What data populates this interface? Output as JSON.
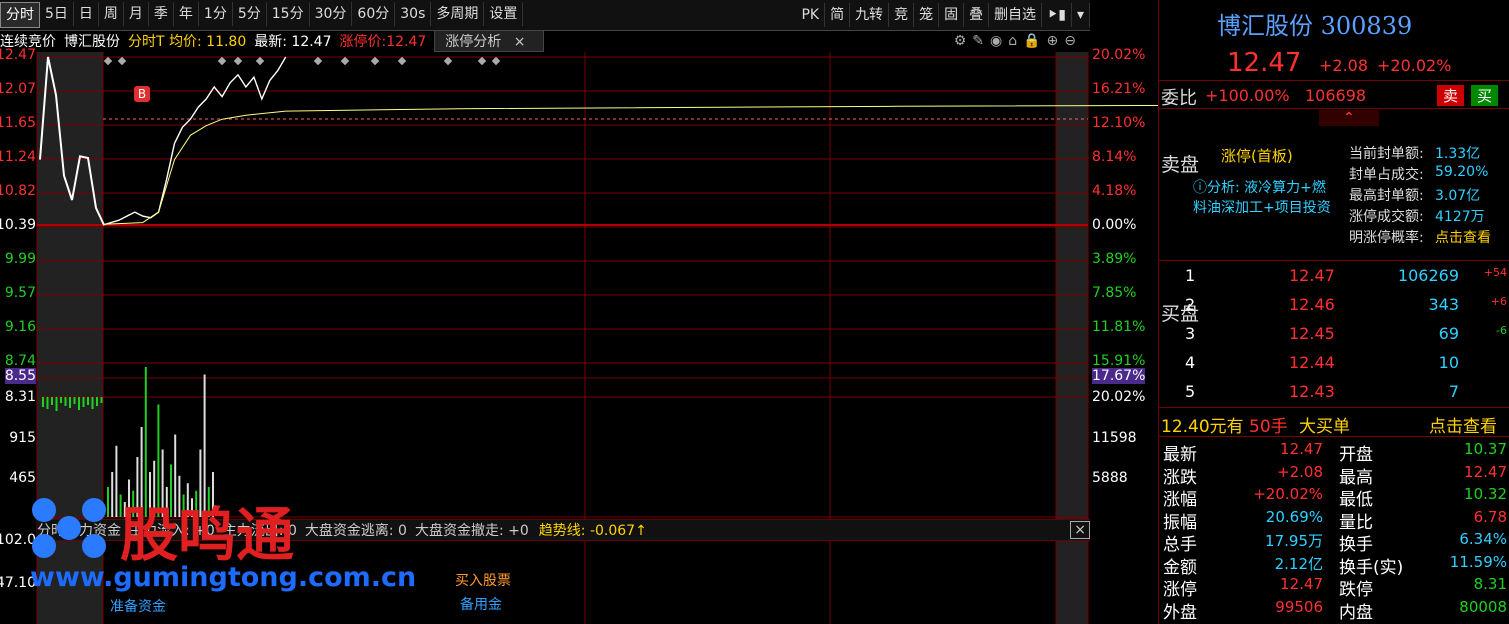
{
  "toolbar": {
    "left": [
      "分时",
      "5日",
      "日",
      "周",
      "月",
      "季",
      "年",
      "1分",
      "5分",
      "15分",
      "30分",
      "60分",
      "30s",
      "多周期",
      "设置"
    ],
    "right": [
      "PK",
      "简",
      "九转",
      "竞",
      "笼",
      "固",
      "叠",
      "删自选"
    ]
  },
  "info": {
    "auction": "连续竞价",
    "stock_name": "博汇股份",
    "avg": "分时T 均价: 11.80",
    "latest": "最新: 12.47",
    "limit": "涨停价:12.47",
    "analysis_btn": "涨停分析"
  },
  "price_axis_left": [
    "12.47",
    "12.07",
    "11.65",
    "11.24",
    "10.82",
    "10.39",
    "9.99",
    "9.57",
    "9.16",
    "8.74",
    "8.55"
  ],
  "pct_axis_right": [
    "20.02%",
    "16.21%",
    "12.10%",
    "8.14%",
    "4.18%",
    "0.00%",
    "3.89%",
    "7.85%",
    "11.81%",
    "15.91%",
    "17.67%"
  ],
  "vol_axis_left": [
    "8.31",
    "915",
    "465",
    "102.0",
    "47.10"
  ],
  "vol_axis_right": [
    "20.02%",
    "11598",
    "5888"
  ],
  "buy_marker": "B",
  "flow_bar": {
    "items": [
      "分时主力资金",
      "主力流入: +0",
      "主力流出: 0",
      "大盘资金逃离: 0",
      "大盘资金撤走: +0"
    ],
    "trend": "趋势线: -0.067↑"
  },
  "indicator_labels": {
    "buy": "买入股票",
    "prepare": "准备资金",
    "reserve": "备用金"
  },
  "watermark": {
    "brand": "股鸣通",
    "url": "www.gumingtong.com.cn"
  },
  "chart_data": {
    "type": "line",
    "title": "",
    "prev_close": 10.39,
    "limit_up": 12.47,
    "ylim": [
      8.31,
      12.47
    ],
    "price_series": [
      [
        0,
        10.39
      ],
      [
        4,
        10.45
      ],
      [
        8,
        10.55
      ],
      [
        10,
        10.5
      ],
      [
        12,
        10.48
      ],
      [
        14,
        10.55
      ],
      [
        16,
        10.95
      ],
      [
        18,
        11.4
      ],
      [
        20,
        11.6
      ],
      [
        22,
        11.7
      ],
      [
        24,
        11.85
      ],
      [
        26,
        11.95
      ],
      [
        28,
        12.1
      ],
      [
        30,
        11.98
      ],
      [
        32,
        12.15
      ],
      [
        34,
        12.25
      ],
      [
        36,
        12.1
      ],
      [
        38,
        12.22
      ],
      [
        40,
        11.95
      ],
      [
        42,
        12.18
      ],
      [
        44,
        12.3
      ],
      [
        46,
        12.47
      ]
    ],
    "avg_series": [
      [
        0,
        10.4
      ],
      [
        10,
        10.42
      ],
      [
        14,
        10.55
      ],
      [
        18,
        11.2
      ],
      [
        22,
        11.5
      ],
      [
        26,
        11.62
      ],
      [
        30,
        11.7
      ],
      [
        36,
        11.75
      ],
      [
        46,
        11.8
      ],
      [
        90,
        11.83
      ],
      [
        200,
        11.86
      ],
      [
        330,
        11.88
      ],
      [
        450,
        11.9
      ]
    ],
    "auction_series": [
      [
        0,
        11.2
      ],
      [
        1,
        12.47
      ],
      [
        2,
        12.0
      ],
      [
        3,
        11.0
      ],
      [
        4,
        10.7
      ],
      [
        5,
        11.24
      ],
      [
        6,
        11.22
      ],
      [
        7,
        10.6
      ],
      [
        8,
        10.39
      ]
    ],
    "volume_series": [
      40,
      60,
      95,
      30,
      20,
      50,
      35,
      80,
      120,
      200,
      60,
      75,
      150,
      90,
      40,
      70,
      110,
      55,
      30,
      45,
      25,
      35,
      90,
      190,
      40,
      60
    ]
  },
  "right_panel": {
    "name_code": "博汇股份 300839",
    "price": "12.47",
    "change": "+2.08",
    "change_pct": "+20.02%",
    "wei_label": "委比",
    "wei_pct": "+100.00%",
    "wei_num": "106698",
    "sell_btn": "卖",
    "buy_btn": "买",
    "sell_side": "卖盘",
    "limit_status": "涨停(首板)",
    "analysis": "ⓘ分析: 液冷算力+燃料油深加工+项目投资",
    "seal_info": [
      [
        "当前封单额:",
        "1.33亿"
      ],
      [
        "封单占成交:",
        "59.20%"
      ],
      [
        "最高封单额:",
        "3.07亿"
      ],
      [
        "涨停成交额:",
        "4127万"
      ],
      [
        "明涨停概率:",
        "点击查看"
      ]
    ],
    "buy_side": "买盘",
    "bids": [
      [
        "1",
        "12.47",
        "106269",
        "+54"
      ],
      [
        "2",
        "12.46",
        "343",
        "+6"
      ],
      [
        "3",
        "12.45",
        "69",
        "-6"
      ],
      [
        "4",
        "12.44",
        "10",
        ""
      ],
      [
        "5",
        "12.43",
        "7",
        ""
      ]
    ],
    "big_order": {
      "price": "12.40元有",
      "qty": "50手",
      "text": "大买单",
      "link": "点击查看"
    },
    "stats": [
      [
        "最新",
        "12.47",
        "开盘",
        "10.37"
      ],
      [
        "涨跌",
        "+2.08",
        "最高",
        "12.47"
      ],
      [
        "涨幅",
        "+20.02%",
        "最低",
        "10.32"
      ],
      [
        "振幅",
        "20.69%",
        "量比",
        "6.78"
      ],
      [
        "总手",
        "17.95万",
        "换手",
        "6.34%"
      ],
      [
        "金额",
        "2.12亿",
        "换手(实)",
        "11.59%"
      ],
      [
        "涨停",
        "12.47",
        "跌停",
        "8.31"
      ],
      [
        "外盘",
        "99506",
        "内盘",
        "80008"
      ]
    ]
  },
  "colors": {
    "up": "#ff3030",
    "down": "#20d020",
    "grid": "#7a0000",
    "avg": "#ffff80"
  }
}
